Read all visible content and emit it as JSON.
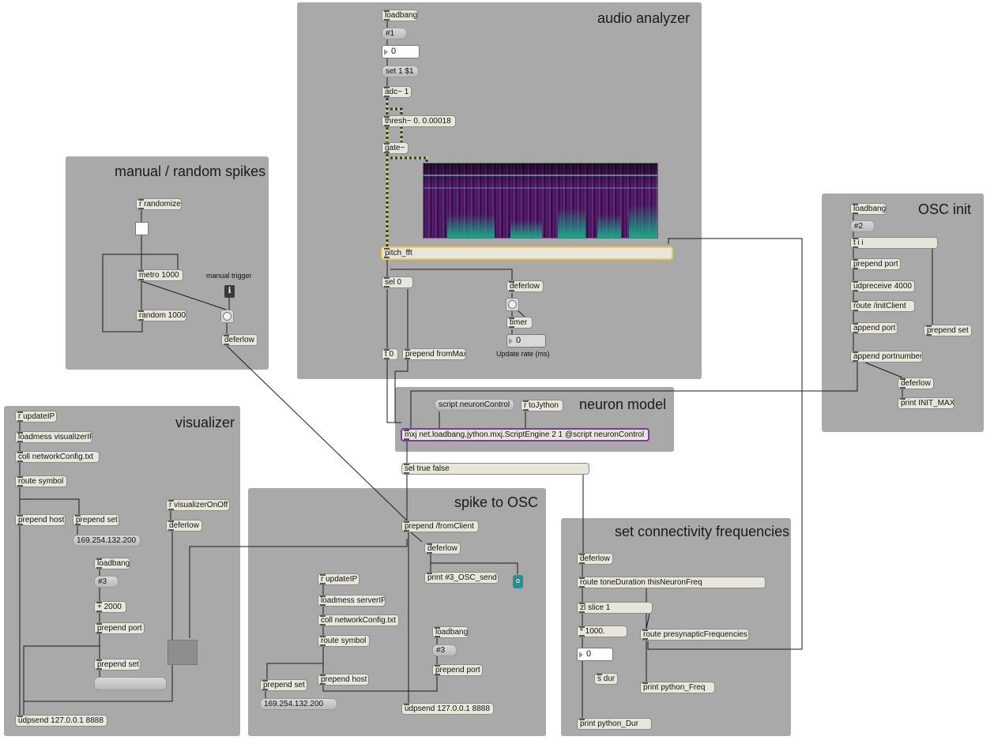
{
  "panels": {
    "audio_analyzer": "audio analyzer",
    "manual_random": "manual / random spikes",
    "osc_init": "OSC init",
    "visualizer": "visualizer",
    "neuron_model": "neuron model",
    "spike_to_osc": "spike to OSC",
    "set_connectivity": "set connectivity frequencies"
  },
  "audio": {
    "loadbang": "loadbang",
    "arg": "#1",
    "num": "0",
    "set_msg": "set 1 $1",
    "adc": "adc~ 1",
    "thresh": "thresh~ 0. 0.00018",
    "gate": "gate~",
    "pitch_fft": "pitch_fft",
    "sel0": "sel 0",
    "deferlow": "deferlow",
    "timer": "timer",
    "timer_num": "0",
    "update_rate": "Update rate (ms)",
    "t0": "t 0",
    "prepend_from_max": "prepend fromMax"
  },
  "manual": {
    "r_randomize": "r randomize",
    "metro": "metro 1000",
    "random": "random 1000",
    "manual_trigger": "manual trigger",
    "info": "i",
    "deferlow": "deferlow"
  },
  "osc": {
    "loadbang": "loadbang",
    "arg": "#2",
    "tii": "t i i",
    "prepend_port": "prepend port",
    "udpreceive": "udpreceive 4000",
    "route_init": "route /initClient",
    "append_port": "append port",
    "prepend_set": "prepend set",
    "append_portnumber": "append portnumber",
    "deferlow": "deferlow",
    "print_init": "print INIT_MAX"
  },
  "vis": {
    "r_updateip": "r updateIP",
    "loadmess": "loadmess visualizerIP",
    "coll": "coll networkConfig.txt",
    "route_symbol": "route symbol",
    "r_onoff": "r visualizerOnOff",
    "deferlow": "deferlow",
    "prepend_host": "prepend host",
    "prepend_set": "prepend set",
    "ip": "169.254.132.200",
    "loadbang": "loadbang",
    "arg": "#3",
    "plus": "+ 2000",
    "prepend_port": "prepend port",
    "prepend_set2": "prepend set",
    "udpsend": "udpsend 127.0.0.1 8888"
  },
  "neuron": {
    "script": "script neuronControl",
    "r_tojython": "r toJython",
    "mxj": "mxj net.loadbang.jython.mxj.ScriptEngine 2 1 @script neuronControl",
    "sel_true_false": "sel true false"
  },
  "spike": {
    "prepend_fromclient": "prepend /fromClient",
    "deferlow": "deferlow",
    "print_send": "print #3_OSC_send",
    "print_icon": "o",
    "r_updateip": "r updateIP",
    "loadmess": "loadmess serverIP",
    "coll": "coll networkConfig.txt",
    "route_symbol": "route symbol",
    "loadbang": "loadbang",
    "arg": "#3",
    "prepend_port": "prepend port",
    "prepend_set": "prepend set",
    "prepend_host": "prepend host",
    "ip": "169.254.132.200",
    "udpsend": "udpsend 127.0.0.1 8888"
  },
  "conn": {
    "deferlow": "deferlow",
    "route_tone": "route toneDuration thisNeuronFreq",
    "zl_slice": "zl slice 1",
    "mult": "* 1000.",
    "num": "0",
    "s_dur": "s dur",
    "print_dur": "print python_Dur",
    "route_presyn": "route presynapticFrequencies",
    "print_freq": "print python_Freq"
  }
}
